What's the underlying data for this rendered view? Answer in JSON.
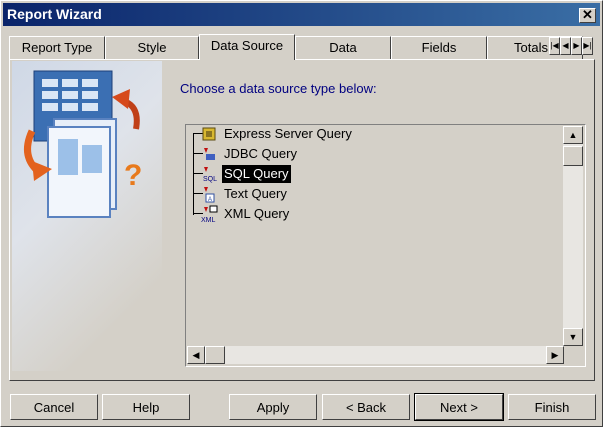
{
  "window": {
    "title": "Report Wizard",
    "close_glyph": "✕"
  },
  "tabs": [
    "Report Type",
    "Style",
    "Data Source",
    "Data",
    "Fields",
    "Totals"
  ],
  "active_tab": "Data Source",
  "prompt": "Choose a data source type below:",
  "tree_items": [
    {
      "label": "Express Server Query",
      "icon": "express-server-icon"
    },
    {
      "label": "JDBC Query",
      "icon": "jdbc-icon"
    },
    {
      "label": "SQL Query",
      "icon": "sql-icon",
      "selected": true
    },
    {
      "label": "Text Query",
      "icon": "text-query-icon"
    },
    {
      "label": "XML Query",
      "icon": "xml-icon"
    }
  ],
  "buttons": {
    "cancel": "Cancel",
    "help": "Help",
    "apply": "Apply",
    "back": "< Back",
    "next": "Next >",
    "finish": "Finish"
  }
}
